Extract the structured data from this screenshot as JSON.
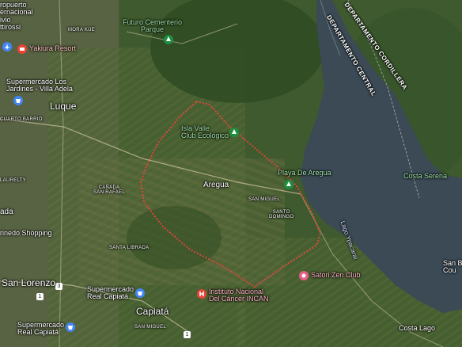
{
  "map": {
    "labels": {
      "airport_1": "ropuerto",
      "airport_2": "ernacional",
      "airport_3": "ivio",
      "airport_4": "ttirossi",
      "moraque": "MORA KUE",
      "cementerio_1": "Futuro Cementerio",
      "cementerio_2": "Parque",
      "yakiura": "Yakiura Resort",
      "super_los_1": "Supermercado Los",
      "super_los_2": "Jardines - Villa Adela",
      "luque": "Luque",
      "cuarto_barrio": "CUARTO BARRIO",
      "isla_valle_1": "Isla Valle",
      "isla_valle_2": "Club Ecológico",
      "playa": "Playa De Aregua",
      "aregua": "Aregua",
      "san_miguel": "SAN MIGUEL",
      "santo_domingo_1": "SANTO",
      "santo_domingo_2": "DOMINGO",
      "canada_1": "CAÑADA",
      "canada_2": "SAN RAFAEL",
      "laurelty": "LAURELTY",
      "ada": "ada",
      "shopping": "rinedo Shopping",
      "santa_librada": "SANTA LIBRADA",
      "san_lorenzo": "San Lorenzo",
      "super_real_1": "Supermercado",
      "super_real_2": "Real Capiatá",
      "super_real_b1": "Supermercado",
      "super_real_b2": "Real Capiatá",
      "capiata": "Capiatá",
      "san_miguel_2": "SAN MIGUEL",
      "incan_1": "Instituto Nacional",
      "incan_2": "Del Cáncer INCAN",
      "satori": "Satori Zen Club",
      "costa_serena": "Costa Serena",
      "costa_lago": "Costa Lago",
      "lago": "Lago Ypacaraí",
      "san_be_1": "San Be",
      "san_be_2": "Cou",
      "dept_cordillera": "DEPARTAMENTO CORDILLERA",
      "dept_central": "DEPARTAMENTO CENTRAL"
    },
    "road_shields": {
      "r1": "1",
      "r2": "3",
      "r3": "1"
    },
    "colors": {
      "boundary": "#e0463c",
      "lake": "#3b4a55",
      "pin_green": "#1e8e3e",
      "pin_blue": "#4285f4",
      "pin_pink": "#e8608a",
      "pin_red": "#ea4335"
    },
    "icons": [
      "airport-icon",
      "park-icon",
      "hotel-icon",
      "shopping-icon",
      "hospital-icon",
      "spa-icon"
    ]
  }
}
